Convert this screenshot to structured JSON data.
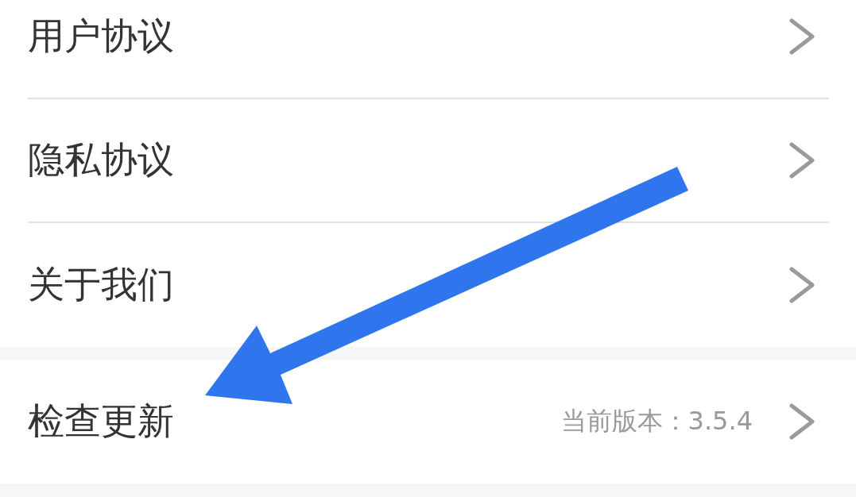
{
  "groups": [
    {
      "items": [
        {
          "label": "用户协议"
        },
        {
          "label": "隐私协议"
        },
        {
          "label": "关于我们"
        }
      ]
    },
    {
      "items": [
        {
          "label": "检查更新",
          "value": "当前版本：3.5.4"
        }
      ]
    }
  ],
  "annotation": {
    "kind": "arrow"
  }
}
